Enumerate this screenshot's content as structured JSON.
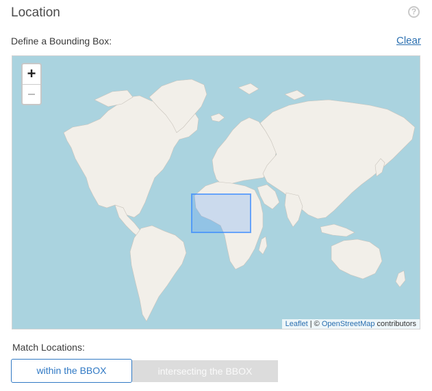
{
  "section": {
    "title": "Location",
    "help_icon": "question-circle-icon"
  },
  "bbox": {
    "label": "Define a Bounding Box:",
    "clear_label": "Clear"
  },
  "map": {
    "zoom_in_label": "+",
    "attribution": {
      "leaflet": "Leaflet",
      "separator": " | © ",
      "osm": "OpenStreetMap",
      "suffix": " contributors"
    },
    "colors": {
      "water": "#aad3df",
      "land": "#f2efe9",
      "selection": "#3388ff"
    }
  },
  "match": {
    "label": "Match Locations:",
    "options": [
      "within the BBOX",
      "intersecting the BBOX"
    ],
    "selected": "within the BBOX"
  }
}
